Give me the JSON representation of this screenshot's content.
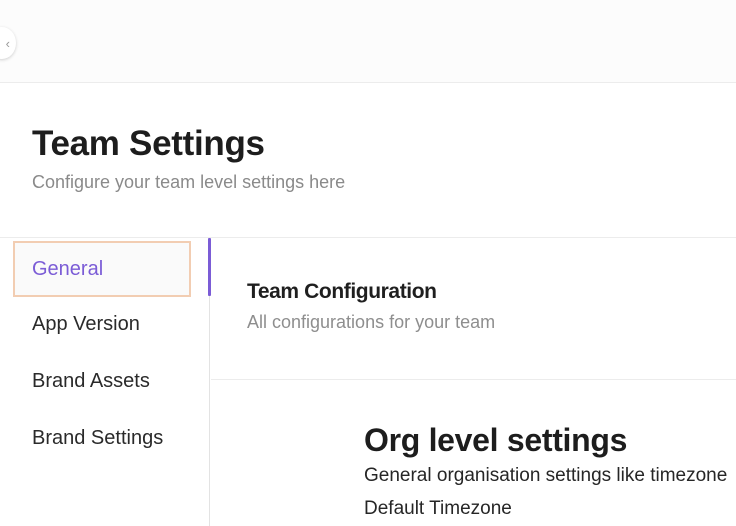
{
  "topbar": {
    "collapse_icon": "chevron-left-icon",
    "collapse_glyph": "‹"
  },
  "page": {
    "title": "Team Settings",
    "subtitle": "Configure your team level settings here"
  },
  "sidebar": {
    "items": [
      {
        "label": "General",
        "active": true
      },
      {
        "label": "App Version",
        "active": false
      },
      {
        "label": "Brand Assets",
        "active": false
      },
      {
        "label": "Brand Settings",
        "active": false
      }
    ]
  },
  "section": {
    "title": "Team Configuration",
    "subtitle": "All configurations for your team"
  },
  "org": {
    "title": "Org level settings",
    "description": "General organisation settings like timezone",
    "field_label": "Default Timezone"
  },
  "colors": {
    "accent": "#7b5cd6",
    "active_outline": "#f2cdb2",
    "muted_text": "#8a8a8a"
  }
}
